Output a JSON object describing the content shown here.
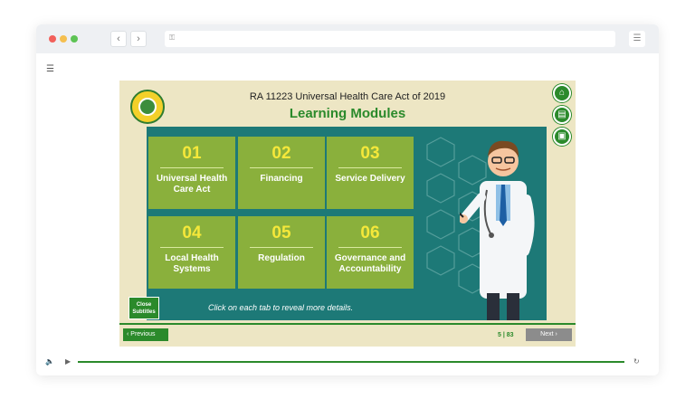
{
  "browser": {
    "window_dots": [
      "#f2605b",
      "#f5bf4f",
      "#5dc354"
    ],
    "back_icon": "‹",
    "forward_icon": "›",
    "lock_icon": "🔒",
    "menu_icon": "☰"
  },
  "slide": {
    "title": "RA 11223 Universal Health Care Act of 2019",
    "subtitle": "Learning Modules",
    "controls": [
      "home-icon",
      "document-icon",
      "folder-icon"
    ],
    "tiles": [
      {
        "num": "01",
        "label": "Universal Health Care Act"
      },
      {
        "num": "02",
        "label": "Financing"
      },
      {
        "num": "03",
        "label": "Service Delivery"
      },
      {
        "num": "04",
        "label": "Local Health Systems"
      },
      {
        "num": "05",
        "label": "Regulation"
      },
      {
        "num": "06",
        "label": "Governance and Accountability"
      }
    ],
    "instruction": "Click on each tab to reveal more details.",
    "close_subtitles": "Close Subtitles",
    "previous_label": "Previous",
    "next_label": "Next",
    "page_indicator": "5 | 83",
    "accent_color": "#2b8a2b",
    "tile_color": "#8ab03c",
    "panel_color": "#1d7977"
  },
  "player": {
    "volume_icon": "volume-icon",
    "play_icon": "play-icon",
    "replay_icon": "replay-icon",
    "progress": 1.0
  }
}
